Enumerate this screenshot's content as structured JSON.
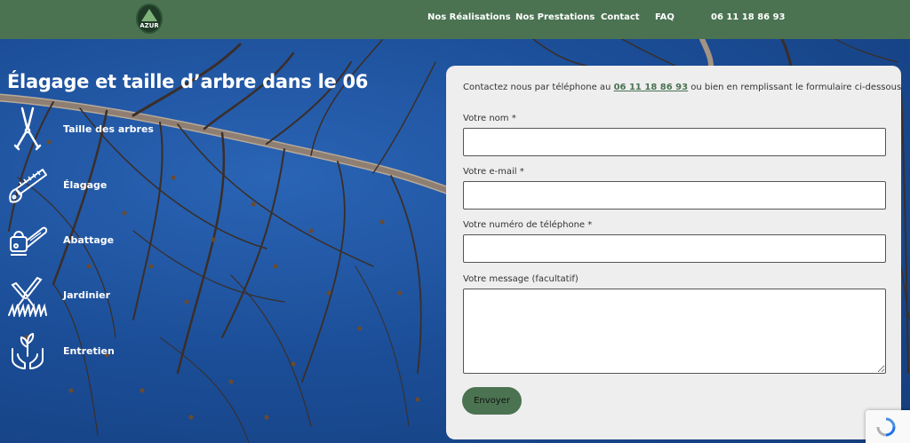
{
  "header": {
    "logo_text": "AZUR",
    "nav": [
      {
        "label": "Nos Réalisations"
      },
      {
        "label": "Nos Prestations"
      },
      {
        "label": "Contact"
      },
      {
        "label": "FAQ"
      },
      {
        "label": "06 11 18 86 93"
      }
    ]
  },
  "hero": {
    "title_strong": "Élag",
    "title_rest": "age et taille d’arbre dans le 06"
  },
  "services": [
    {
      "label": "Taille des arbres",
      "icon": "pruning-shears-icon"
    },
    {
      "label": "Élagage",
      "icon": "handsaw-icon"
    },
    {
      "label": "Abattage",
      "icon": "chainsaw-icon"
    },
    {
      "label": "Jardinier",
      "icon": "hedge-trimmer-icon"
    },
    {
      "label": "Entretien",
      "icon": "plant-hands-icon"
    }
  ],
  "form": {
    "intro_before": "Contactez nous par téléphone au ",
    "intro_phone": "06 11 18 86 93",
    "intro_after": " ou bien en remplissant le formulaire ci-dessous",
    "name_label": "Votre nom *",
    "name_value": "",
    "email_label": "Votre e-mail *",
    "email_value": "",
    "phone_label": "Votre numéro de téléphone *",
    "phone_value": "",
    "message_label": "Votre message (facultatif)",
    "message_value": "",
    "submit_label": "Envoyer"
  },
  "colors": {
    "brand_green": "#4b7352",
    "sky_blue": "#1e4f9a",
    "card_bg": "#eeeeee"
  }
}
